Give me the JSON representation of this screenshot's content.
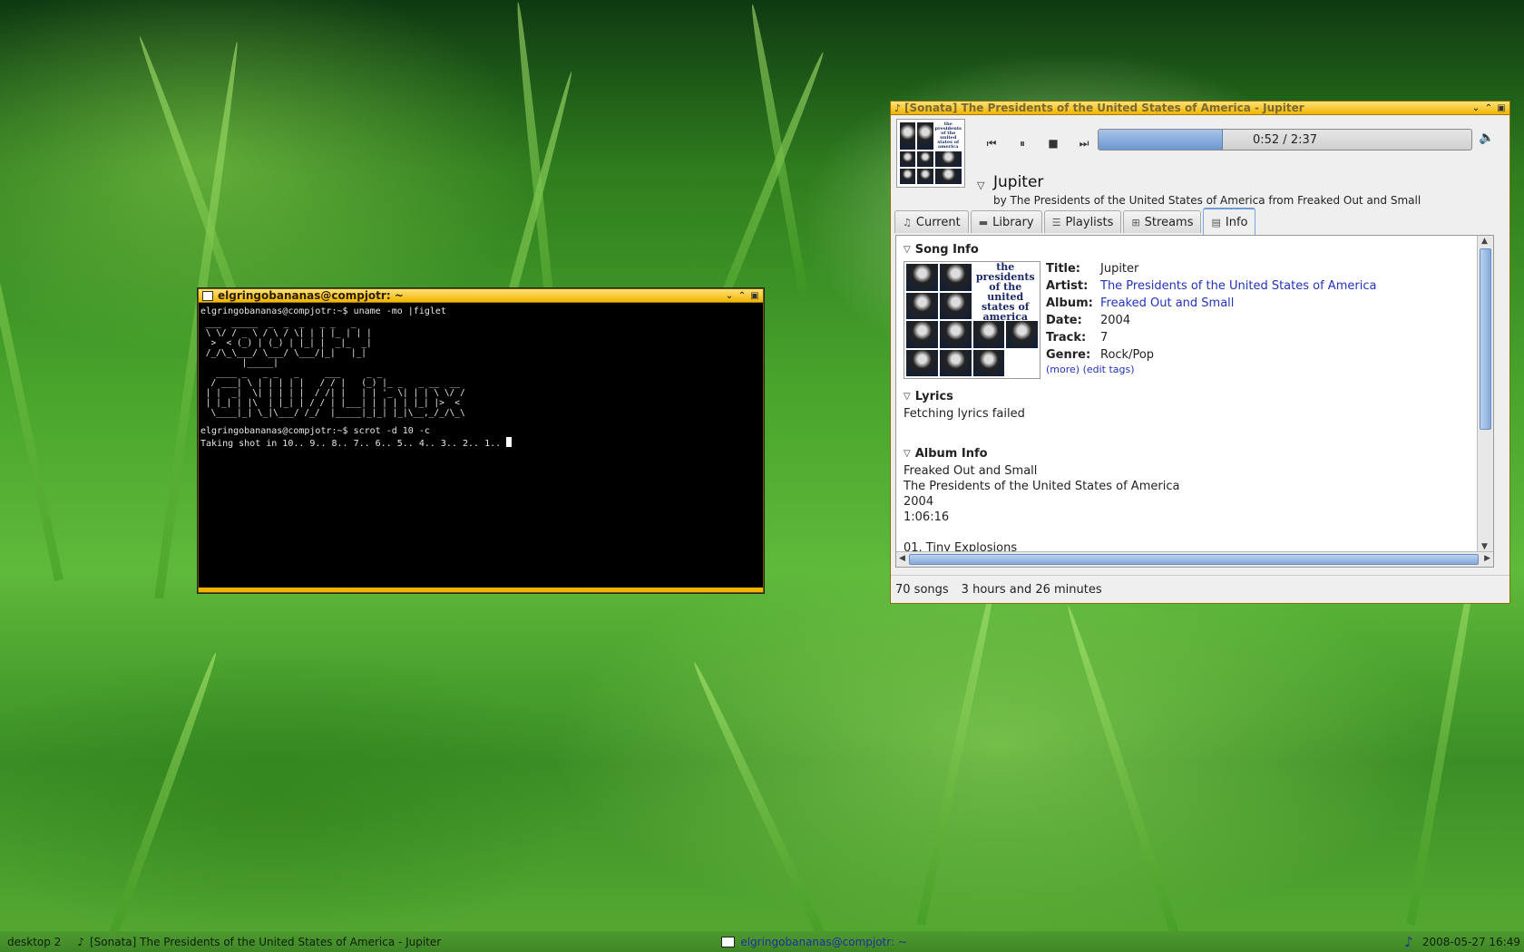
{
  "terminal": {
    "title": "elgringobananas@compjotr: ~",
    "lines": [
      "elgringobananas@compjotr:~$ uname -mo |figlet",
      "elgringobananas@compjotr:~$ scrot -d 10 -c",
      "Taking shot in 10.. 9.. 8.. 7.. 6.. 5.. 4.. 3.. 2.. 1.."
    ],
    "figlet": " ___  _____  _  _  _   _ _   _ \n \\ \\/ / _ \\ / \\ / \\| | | |_ | | |\n  >  < (_) | (_) | |_| |  _|_  _|\n /_/\\_\\___/ \\___/ \\___/|_|   |_|\n        |_____|\n   ____ _   _ _   _     ___     _ _                \n  / ___| \\ | | | | |   / / |   (_) |_ _   _ __  __\n | |  _|  \\| | | | |  / /| |   | | '_ \\| | | \\ \\/ /\n | |_| | |\\  | |_| | / / | |___| | | | | |_| |>  < \n  \\____|_| \\_|\\___/ /_/  |_____|_|_| |_|\\__,_/_/\\_\\"
  },
  "sonata": {
    "title": "[Sonata] The Presidents of the United States of America - Jupiter",
    "time": "0:52 / 2:37",
    "progress_fraction": 0.331,
    "song_title": "Jupiter",
    "song_subtitle": "by The Presidents of the United States of America from Freaked Out and Small",
    "cover_text": "the presidents of the united states of america",
    "tabs": [
      {
        "label": "Current",
        "icon": "current-icon"
      },
      {
        "label": "Library",
        "icon": "library-icon"
      },
      {
        "label": "Playlists",
        "icon": "playlists-icon"
      },
      {
        "label": "Streams",
        "icon": "streams-icon"
      },
      {
        "label": "Info",
        "icon": "info-icon",
        "active": true
      }
    ],
    "song_info": {
      "heading": "Song Info",
      "fields": [
        {
          "key": "Title:",
          "value": "Jupiter",
          "link": false
        },
        {
          "key": "Artist:",
          "value": "The Presidents of the United States of America",
          "link": true
        },
        {
          "key": "Album:",
          "value": "Freaked Out and Small",
          "link": true
        },
        {
          "key": "Date:",
          "value": "2004",
          "link": false
        },
        {
          "key": "Track:",
          "value": "7",
          "link": false
        },
        {
          "key": "Genre:",
          "value": "Rock/Pop",
          "link": false
        }
      ],
      "more_link": "(more)",
      "edit_tags_link": "(edit tags)"
    },
    "lyrics": {
      "heading": "Lyrics",
      "text": "Fetching lyrics failed"
    },
    "album_info": {
      "heading": "Album Info",
      "lines": [
        "Freaked Out and Small",
        "The Presidents of the United States of America",
        "2004",
        "1:06:16"
      ],
      "first_track": "01. Tiny Explosions"
    },
    "status": {
      "songs": "70 songs",
      "duration": "3 hours and 26 minutes"
    }
  },
  "taskbar": {
    "desktop": "desktop 2",
    "task_sonata": "[Sonata] The Presidents of the United States of America - Jupiter",
    "task_terminal": "elgringobananas@compjotr: ~",
    "clock": "2008-05-27 16:49"
  },
  "colors": {
    "titlebar": "#f2b400",
    "link": "#2233bb",
    "progress": "#6d97cf"
  }
}
